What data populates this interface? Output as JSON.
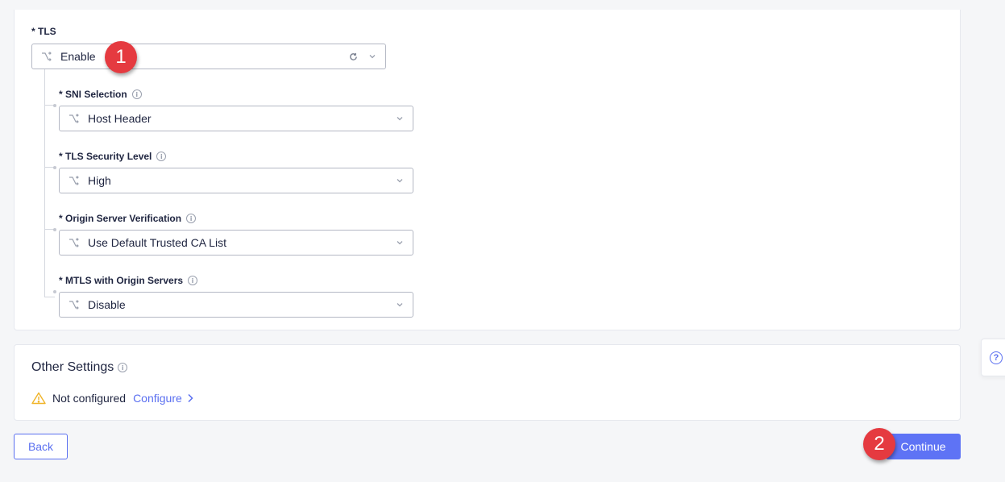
{
  "tls": {
    "label": "* TLS",
    "value": "Enable",
    "fields": [
      {
        "label": "* SNI Selection",
        "value": "Host Header"
      },
      {
        "label": "* TLS Security Level",
        "value": "High"
      },
      {
        "label": "* Origin Server Verification",
        "value": "Use Default Trusted CA List"
      },
      {
        "label": "* MTLS with Origin Servers",
        "value": "Disable"
      }
    ]
  },
  "other_settings": {
    "title": "Other Settings",
    "status": "Not configured",
    "configure_link": "Configure"
  },
  "footer": {
    "back_label": "Back",
    "continue_label": "Continue"
  },
  "annotations": {
    "badge_1": "1",
    "badge_2": "2"
  },
  "help": {
    "icon_glyph": "?"
  },
  "colors": {
    "accent": "#5e73f5",
    "badge": "#e53a40",
    "warning": "#f0b429"
  }
}
